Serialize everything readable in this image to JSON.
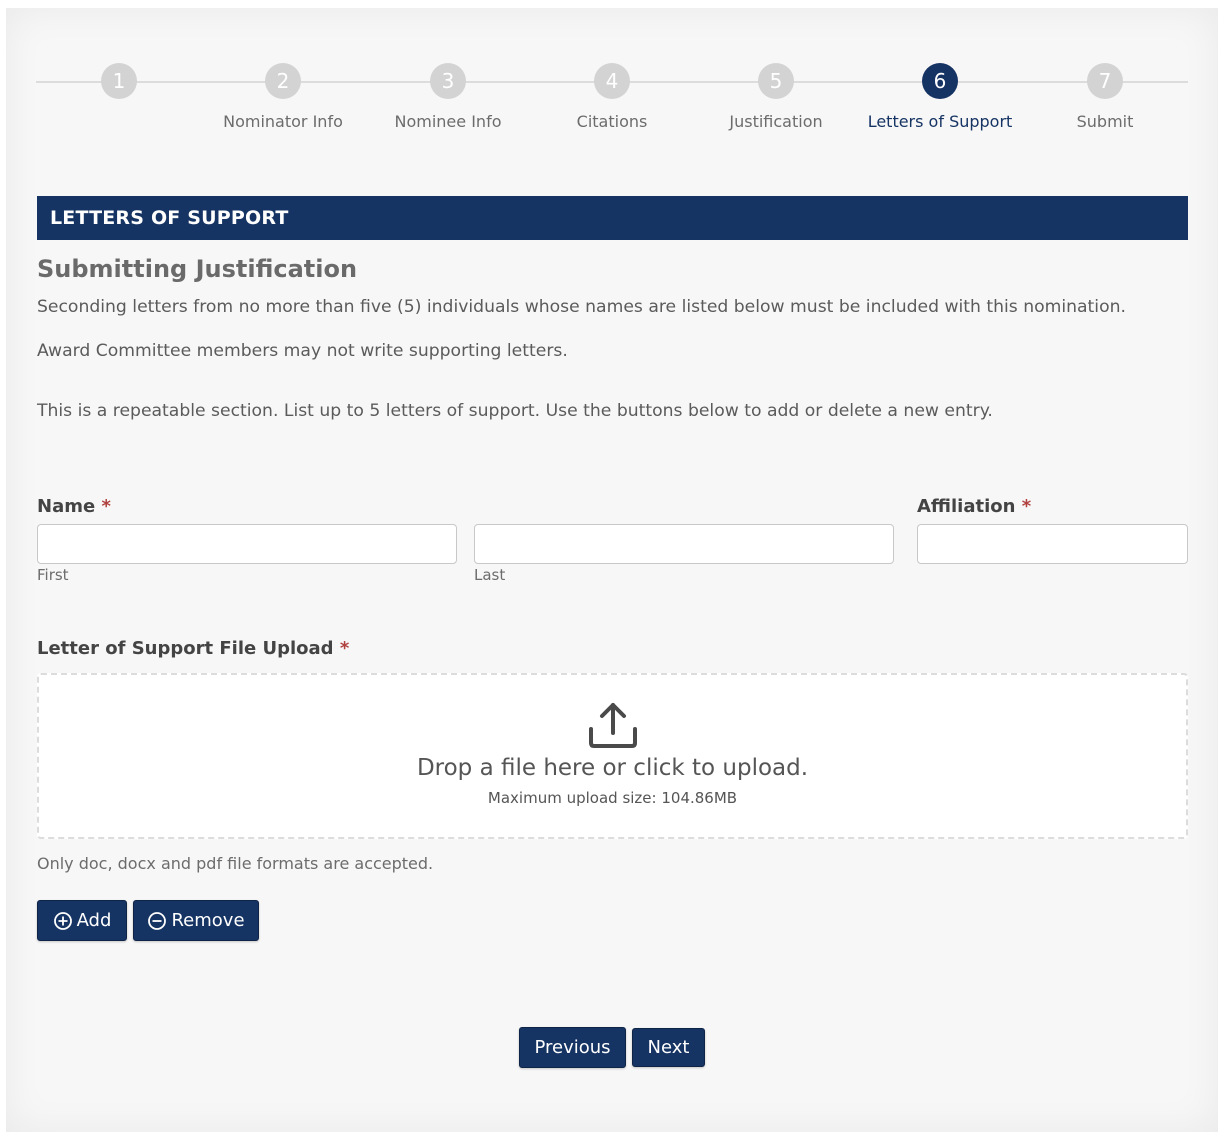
{
  "stepper": {
    "steps": [
      {
        "number": "1",
        "label": ""
      },
      {
        "number": "2",
        "label": "Nominator Info"
      },
      {
        "number": "3",
        "label": "Nominee Info"
      },
      {
        "number": "4",
        "label": "Citations"
      },
      {
        "number": "5",
        "label": "Justification"
      },
      {
        "number": "6",
        "label": "Letters of Support"
      },
      {
        "number": "7",
        "label": "Submit"
      }
    ],
    "active_step": "6"
  },
  "section": {
    "title": "LETTERS OF SUPPORT",
    "subtitle": "Submitting Justification",
    "paragraphs": [
      "Seconding letters from no more than five (5) individuals whose names are listed below must be included with this nomination.",
      "Award Committee members may not write supporting letters.",
      "This is a repeatable section. List up to 5 letters of support. Use the buttons below to add or delete a new entry."
    ]
  },
  "form": {
    "name_label": "Name",
    "required_marker": "*",
    "first_value": "",
    "first_hint": "First",
    "last_value": "",
    "last_hint": "Last",
    "affiliation_label": "Affiliation",
    "affiliation_value": "",
    "upload_label": "Letter of Support File Upload",
    "dropzone_text": "Drop a file here or click to upload.",
    "max_size_text": "Maximum upload size: 104.86MB",
    "formats_note": "Only doc, docx and pdf file formats are accepted."
  },
  "buttons": {
    "add": "Add",
    "remove": "Remove",
    "previous": "Previous",
    "next": "Next"
  },
  "colors": {
    "primary": "#163463",
    "required": "#b0413e",
    "step_inactive": "#d3d3d3"
  }
}
